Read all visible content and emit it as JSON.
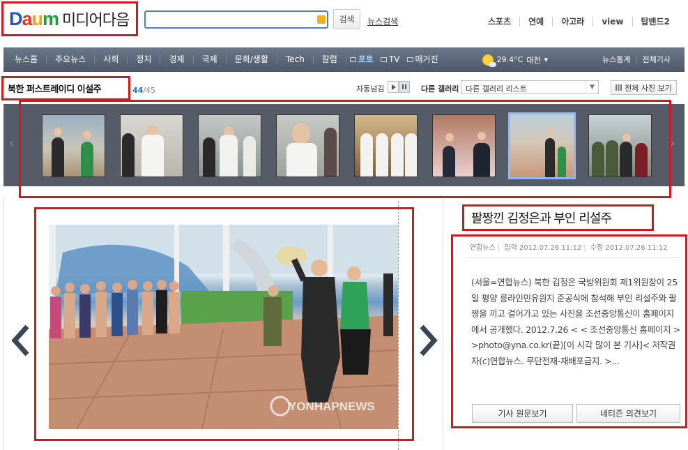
{
  "header": {
    "logo_text": "Daum",
    "logo_subtitle": "미디어다음",
    "search_button": "검색",
    "news_search_link": "뉴스검색",
    "top_links": [
      "스포츠",
      "연예",
      "아고라",
      "view",
      "탑밴드2"
    ]
  },
  "nav": {
    "items": [
      "뉴스홈",
      "주요뉴스",
      "사회",
      "정치",
      "경제",
      "국제",
      "문화/생활",
      "Tech",
      "칼럼"
    ],
    "media_items": [
      {
        "label": "포토",
        "active": true
      },
      {
        "label": "TV",
        "active": false
      },
      {
        "label": "매거진",
        "active": false
      }
    ],
    "weather": {
      "temperature": "29.4°C",
      "city": "대전"
    },
    "right_links": [
      "뉴스통계",
      "전체기사"
    ]
  },
  "gallery": {
    "title": "북한 퍼스트레이디 이설주",
    "current": "44",
    "total": "/45",
    "autoplay_label": "자동넘김",
    "other_gallery_label": "다른 갤러리",
    "select_value": "다른 갤러리 리스트",
    "all_photos_button": "전체 사진 보기"
  },
  "main_photo": {
    "watermark": "YONHAPNEWS"
  },
  "article": {
    "title": "팔짱낀 김정은과 부인 리설주",
    "source": "연합뉴스",
    "input_label": "입력",
    "input_time": "2012.07.26 11:12",
    "edit_label": "수정",
    "edit_time": "2012.07.26 11:12",
    "body": "(서울=연합뉴스) 북한 김정은 국방위원회 제1위원장이 25일 평양 릉라인민유원지 준공식에 참석해 부인 리설주와 팔짱을 끼고 걸어가고 있는 사진을 조선중앙통신이 홈페이지에서 공개했다. 2012.7.26 < < 조선중앙통신 홈페이지 > >photo@yna.co.kr(끝)[이 시각 많이 본 기사]< 저작권자(c)연합뉴스. 무단전재-재배포금지. >...",
    "btn_original": "기사 원문보기",
    "btn_netizen": "네티즌 의견보기"
  },
  "colors": {
    "highlight_outline": "#d8161e",
    "nav_bg": "#4c5869",
    "active_link": "#9fd3ff"
  }
}
